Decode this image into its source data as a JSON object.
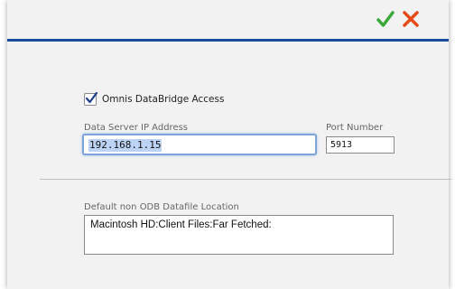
{
  "toolbar": {
    "ok_icon": "checkmark-icon",
    "ok_color": "#3aa83a",
    "cancel_icon": "cross-icon",
    "cancel_color": "#e64a19",
    "header_line_color": "#1b4da0"
  },
  "form": {
    "databridge_checkbox": {
      "label": "Omnis DataBridge Access",
      "checked": true
    },
    "ip_address": {
      "label": "Data Server IP Address",
      "value": "192.168.1.15",
      "focused": true
    },
    "port": {
      "label": "Port Number",
      "value": "5913"
    },
    "datafile_location": {
      "label": "Default non ODB Datafile Location",
      "value": "Macintosh HD:Client Files:Far Fetched:"
    }
  }
}
